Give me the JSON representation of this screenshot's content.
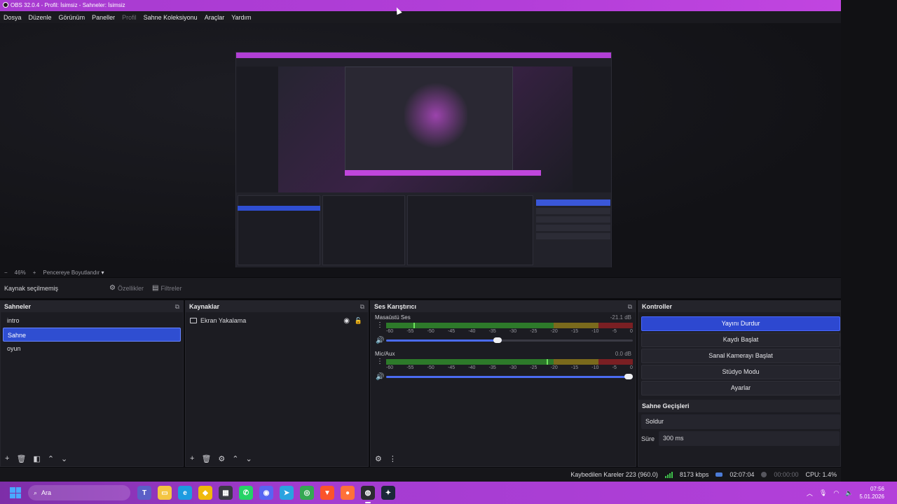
{
  "window": {
    "title": "OBS 32.0.4 - Profil: İsimsiz - Sahneler: İsimsiz"
  },
  "menu": [
    {
      "label": "Dosya",
      "enabled": true
    },
    {
      "label": "Düzenle",
      "enabled": true
    },
    {
      "label": "Görünüm",
      "enabled": true
    },
    {
      "label": "Paneller",
      "enabled": true
    },
    {
      "label": "Profil",
      "enabled": false
    },
    {
      "label": "Sahne Koleksiyonu",
      "enabled": true
    },
    {
      "label": "Araçlar",
      "enabled": true
    },
    {
      "label": "Yardım",
      "enabled": true
    }
  ],
  "zoom": {
    "minus": "−",
    "value": "46%",
    "plus": "+",
    "mode": "Pencereye Boyutlandır"
  },
  "source_toolbar": {
    "no_selection": "Kaynak seçilmemiş",
    "properties": "Özellikler",
    "filters": "Filtreler"
  },
  "scenes": {
    "title": "Sahneler",
    "items": [
      "intro",
      "Sahne",
      "oyun"
    ],
    "selected_index": 1
  },
  "sources": {
    "title": "Kaynaklar",
    "items": [
      {
        "label": "Ekran Yakalama",
        "visible": true,
        "locked": false
      }
    ]
  },
  "mixer": {
    "title": "Ses Karıştırıcı",
    "channels": [
      {
        "name": "Masaüstü Ses",
        "db": "-21.1 dB",
        "level": 0.11,
        "volume": 0.47
      },
      {
        "name": "Mic/Aux",
        "db": "0.0 dB",
        "level": 0.65,
        "volume": 1.0
      }
    ],
    "ticks": [
      "-60",
      "-55",
      "-50",
      "-45",
      "-40",
      "-35",
      "-30",
      "-25",
      "-20",
      "-15",
      "-10",
      "-5",
      "0"
    ]
  },
  "controls": {
    "title": "Kontroller",
    "buttons": [
      "Yayını Durdur",
      "Kaydı Başlat",
      "Sanal Kamerayı Başlat",
      "Stüdyo Modu",
      "Ayarlar"
    ],
    "transitions_title": "Sahne Geçişleri",
    "transition": "Soldur",
    "duration_label": "Süre",
    "duration_value": "300 ms"
  },
  "status": {
    "dropped": "Kaybedilen Kareler 223 (960.0)",
    "bitrate": "8173 kbps",
    "stream_time": "02:07:04",
    "rec_time": "00:00:00",
    "cpu": "CPU: 1.4%"
  },
  "taskbar": {
    "search_placeholder": "Ara",
    "apps": [
      {
        "name": "teams-icon",
        "color": "#5b5fc7",
        "glyph": "T"
      },
      {
        "name": "file-explorer-icon",
        "color": "#f4c542",
        "glyph": "▭"
      },
      {
        "name": "edge-icon",
        "color": "#1c9be0",
        "glyph": "e"
      },
      {
        "name": "binance-icon",
        "color": "#f0b90b",
        "glyph": "◆"
      },
      {
        "name": "calculator-icon",
        "color": "#3a3a44",
        "glyph": "▦"
      },
      {
        "name": "whatsapp-icon",
        "color": "#25d366",
        "glyph": "✆"
      },
      {
        "name": "discord-icon",
        "color": "#5865f2",
        "glyph": "◉"
      },
      {
        "name": "telegram-icon",
        "color": "#2aa3e0",
        "glyph": "➤"
      },
      {
        "name": "chrome-icon",
        "color": "#34a853",
        "glyph": "◎"
      },
      {
        "name": "brave-icon",
        "color": "#fb542b",
        "glyph": "▼"
      },
      {
        "name": "firefox-icon",
        "color": "#ff7139",
        "glyph": "●"
      },
      {
        "name": "obs-icon",
        "color": "#2b2b30",
        "glyph": "◍"
      },
      {
        "name": "steam-icon",
        "color": "#1b2838",
        "glyph": "✦"
      }
    ],
    "time": "07:56",
    "date": "5.01.2026"
  }
}
